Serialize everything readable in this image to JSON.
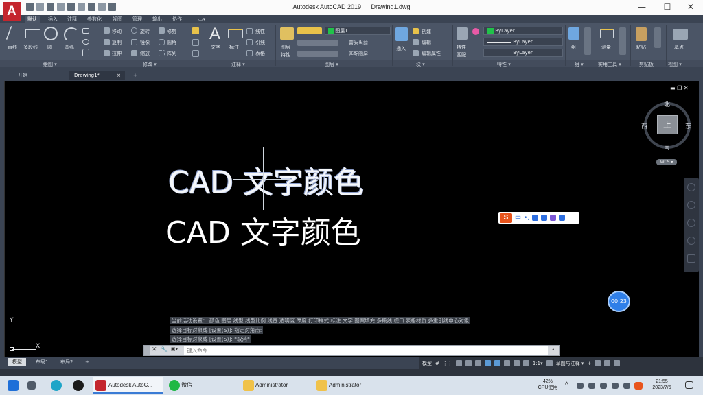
{
  "app": {
    "logo_letter": "A",
    "title": "Autodesk AutoCAD 2019",
    "document": "Drawing1.dwg",
    "controls": {
      "minimize": "—",
      "maximize": "☐",
      "close": "✕"
    }
  },
  "ribbon_tabs": [
    "默认",
    "插入",
    "注释",
    "参数化",
    "视图",
    "管理",
    "输出",
    "协作"
  ],
  "ribbon_tab_overflow": "▭▾",
  "draw_panel": {
    "title": "绘图 ▾",
    "labels": [
      "直线",
      "多段线",
      "圆",
      "圆弧"
    ]
  },
  "modify_panel": {
    "title": "修改 ▾",
    "tools": [
      "移动",
      "旋转",
      "修剪",
      "复制",
      "镜像",
      "圆角",
      "拉伸",
      "缩放",
      "阵列"
    ]
  },
  "annotation_panel": {
    "title": "注释 ▾",
    "labels": [
      "文字",
      "标注"
    ],
    "tools": [
      "线性",
      "引线",
      "表格"
    ]
  },
  "layers_panel": {
    "title": "图层 ▾",
    "labels": [
      "图层",
      "特性"
    ],
    "current_layer": "图层1",
    "tools": [
      "置为当前",
      "匹配图层"
    ]
  },
  "block_panel": {
    "title": "块 ▾",
    "labels": [
      "插入"
    ],
    "tools": [
      "创建",
      "编辑",
      "编辑属性"
    ]
  },
  "properties_panel": {
    "title": "特性 ▾",
    "labels": [
      "特性",
      "匹配"
    ],
    "color": "ByLayer",
    "linetype": "ByLayer",
    "lineweight": "ByLayer"
  },
  "groups_panel": {
    "title": "组 ▾",
    "labels": [
      "组"
    ]
  },
  "utilities_panel": {
    "title": "实用工具 ▾",
    "labels": [
      "测量"
    ]
  },
  "clipboard_panel": {
    "title": "剪贴板",
    "labels": [
      "粘贴"
    ]
  },
  "view_panel": {
    "title": "视图 ▾",
    "labels": [
      "基点"
    ]
  },
  "file_tabs": [
    "开始",
    "Drawing1*"
  ],
  "file_tab_close": "×",
  "file_tab_add": "+",
  "viewport_controls": "▬ ❐ ✕",
  "canvas_text": {
    "line1": "CAD 文字颜色",
    "line2": "CAD 文字颜色"
  },
  "viewcube": {
    "north": "北",
    "south": "南",
    "east": "东",
    "west": "西",
    "face": "上",
    "wcs": "WCS ▾"
  },
  "ime": {
    "logo": "S",
    "mode": "中",
    "punct": "•,"
  },
  "timer": "00:23",
  "command_history": [
    "当前活动设置：  颜色  图层  线型  线型比例  线宽  透明度  厚度  打印样式  标注  文字  图案填充  多段线  视口  表格材质  多重引线中心对象",
    "选择目标对象或 [设置(S)]: 指定对角点:",
    "选择目标对象或 [设置(S)]: *取消*"
  ],
  "command_line": {
    "close": "✕",
    "tool": "🔧",
    "recent": "▣▾",
    "placeholder": "键入命令",
    "expand": "▴"
  },
  "ucs": {
    "x": "X",
    "y": "Y"
  },
  "layout_tabs": [
    "模型",
    "布局1",
    "布局2"
  ],
  "layout_add": "+",
  "status_bar": {
    "model": "模型",
    "snap": "#",
    "grid": "⋮⋮",
    "scale": "1:1▾",
    "workspace": "草图与注释 ▾",
    "plus": "+"
  },
  "taskbar": {
    "apps": [
      "Autodesk AutoC...",
      "微信",
      "Administrator",
      "Administrator"
    ],
    "cpu_percent": "42%",
    "cpu_label": "CPU使用",
    "time": "21:55",
    "date": "2023/7/5",
    "tray_arrow": "^"
  },
  "colors": {
    "ribbon_bg": "#4b5566",
    "tab_bar": "#3b4453",
    "canvas": "#000000",
    "accent_red": "#c4262e",
    "layer_green": "#21c24a",
    "timer_blue": "#2f7fe8"
  }
}
